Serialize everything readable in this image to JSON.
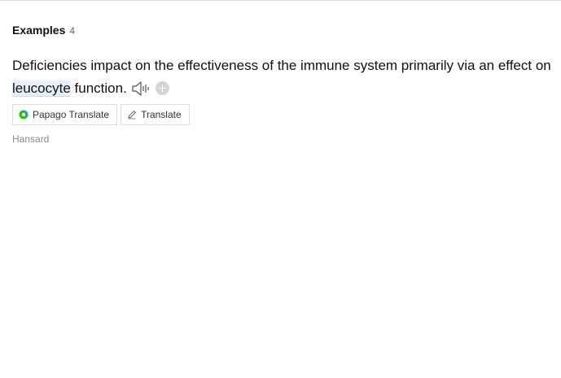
{
  "examples": {
    "heading": "Examples",
    "count": "4"
  },
  "sentence": {
    "before": "Deficiencies impact on the effectiveness of the immune system primarily via an effect on ",
    "highlight": "leucocyte",
    "after": " function."
  },
  "buttons": {
    "papago_label": "Papago Translate",
    "translate_label": "Translate"
  },
  "source": "Hansard",
  "icons": {
    "speaker": "speaker-icon",
    "add": "add-circle-icon",
    "papago": "papago-logo-icon",
    "pencil": "pencil-icon"
  },
  "colors": {
    "highlight_bg": "#e6f0fb",
    "papago_green": "#1ec800",
    "papago_blue": "#2f8ef0"
  }
}
